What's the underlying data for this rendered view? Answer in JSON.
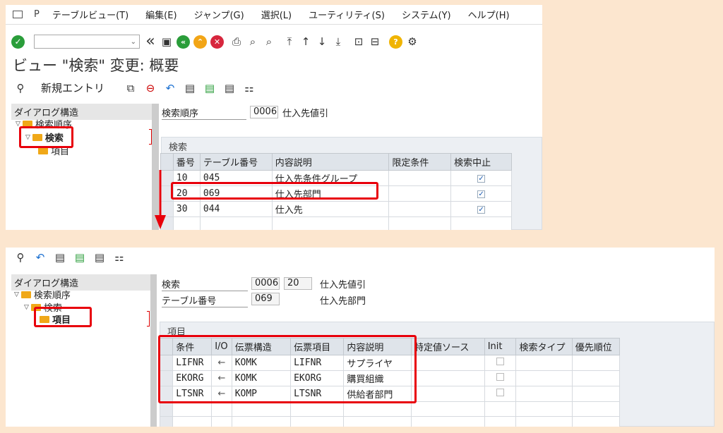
{
  "menu": {
    "items": [
      "テーブルビュー(T)",
      "編集(E)",
      "ジャンプ(G)",
      "選択(L)",
      "ユーティリティ(S)",
      "システム(Y)",
      "ヘルプ(H)"
    ]
  },
  "toolbar": {
    "back_glyph": "«",
    "pa_glyph": "P"
  },
  "screen1": {
    "title": "ビュー \"検索\" 変更: 概要",
    "new_entries_label": "新規エントリ",
    "tree": {
      "header": "ダイアログ構造",
      "items": [
        "検索順序",
        "検索",
        "項目"
      ]
    },
    "header_fields": {
      "label": "検索順序",
      "code": "0006",
      "desc": "仕入先値引"
    },
    "section_title": "検索",
    "table": {
      "columns": [
        "番号",
        "テーブル番号",
        "内容説明",
        "限定条件",
        "検索中止"
      ],
      "rows": [
        {
          "no": "10",
          "table": "045",
          "desc": "仕入先条件グループ",
          "check": "✓"
        },
        {
          "no": "20",
          "table": "069",
          "desc": "仕入先部門",
          "check": "✓"
        },
        {
          "no": "30",
          "table": "044",
          "desc": "仕入先",
          "check": "✓"
        }
      ]
    }
  },
  "screen2": {
    "tree": {
      "header": "ダイアログ構造",
      "items": [
        "検索順序",
        "検索",
        "項目"
      ]
    },
    "header_fields": {
      "label1": "検索",
      "code": "0006",
      "num": "20",
      "desc1": "仕入先値引",
      "label2": "テーブル番号",
      "table": "069",
      "desc2": "仕入先部門"
    },
    "section_title": "項目",
    "table": {
      "columns": [
        "条件",
        "I/O",
        "伝票構造",
        "伝票項目",
        "内容説明",
        "特定値ソース",
        "Init",
        "検索タイプ",
        "優先順位"
      ],
      "rows": [
        {
          "cond": "LIFNR",
          "io": "←",
          "struct": "KOMK",
          "field": "LIFNR",
          "desc": "サプライヤ"
        },
        {
          "cond": "EKORG",
          "io": "←",
          "struct": "KOMK",
          "field": "EKORG",
          "desc": "購買組織"
        },
        {
          "cond": "LTSNR",
          "io": "←",
          "struct": "KOMP",
          "field": "LTSNR",
          "desc": "供給者部門"
        }
      ]
    }
  },
  "colors": {
    "highlight": "#e8000b",
    "enter_green": "#2a9d3a",
    "nav_orange": "#f2a516",
    "cancel_red": "#d7263d",
    "help_yellow": "#f0b400"
  }
}
